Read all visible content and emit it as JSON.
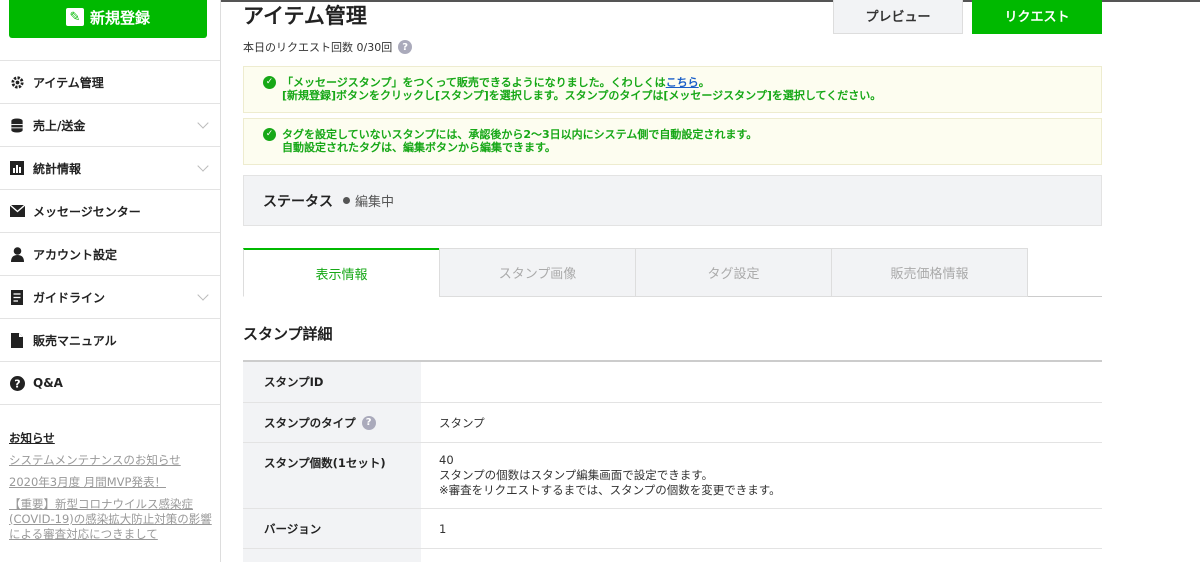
{
  "sidebar": {
    "new_button": "新規登録",
    "items": [
      {
        "label": "アイテム管理",
        "icon": "gear-icon",
        "expandable": false
      },
      {
        "label": "売上/送金",
        "icon": "coins-icon",
        "expandable": true
      },
      {
        "label": "統計情報",
        "icon": "bar-chart-icon",
        "expandable": true
      },
      {
        "label": "メッセージセンター",
        "icon": "mail-icon",
        "expandable": false
      },
      {
        "label": "アカウント設定",
        "icon": "person-icon",
        "expandable": false
      },
      {
        "label": "ガイドライン",
        "icon": "document-icon",
        "expandable": true
      },
      {
        "label": "販売マニュアル",
        "icon": "file-icon",
        "expandable": false
      },
      {
        "label": "Q&A",
        "icon": "question-icon",
        "expandable": false
      }
    ],
    "news": {
      "title": "お知らせ",
      "links": [
        "システムメンテナンスのお知らせ",
        "2020年3月度 月間MVP発表！",
        "【重要】新型コロナウイルス感染症(COVID-19)の感染拡大防止対策の影響による審査対応につきまして"
      ]
    }
  },
  "header": {
    "title": "アイテム管理",
    "request_count": "本日のリクエスト回数 0/30回",
    "preview_label": "プレビュー",
    "request_label": "リクエスト"
  },
  "notices": [
    {
      "line1_pre": "「メッセージスタンプ」をつくって販売できるようになりました。くわしくは",
      "line1_link": "こちら",
      "line1_post": "。",
      "line2": "[新規登録]ボタンをクリックし[スタンプ]を選択します。スタンプのタイプは[メッセージスタンプ]を選択してください。"
    },
    {
      "line1": "タグを設定していないスタンプには、承認後から2〜3日以内にシステム側で自動設定されます。",
      "line2": "自動設定されたタグは、編集ボタンから編集できます。"
    }
  ],
  "status": {
    "label": "ステータス",
    "value": "編集中"
  },
  "tabs": [
    "表示情報",
    "スタンプ画像",
    "タグ設定",
    "販売価格情報"
  ],
  "details": {
    "title": "スタンプ詳細",
    "rows": [
      {
        "label": "スタンプID",
        "value": ""
      },
      {
        "label": "スタンプのタイプ",
        "value": "スタンプ"
      },
      {
        "label": "スタンプ個数(1セット)",
        "value": "40",
        "note1": "スタンプの個数はスタンプ編集画面で設定できます。",
        "note2": "※審査をリクエストするまでは、スタンプの個数を変更できます。"
      },
      {
        "label": "バージョン",
        "value": "1"
      }
    ]
  },
  "colors": {
    "brand_green": "#00b900",
    "notice_green": "#17a817",
    "link_blue": "#1a5fc8"
  }
}
